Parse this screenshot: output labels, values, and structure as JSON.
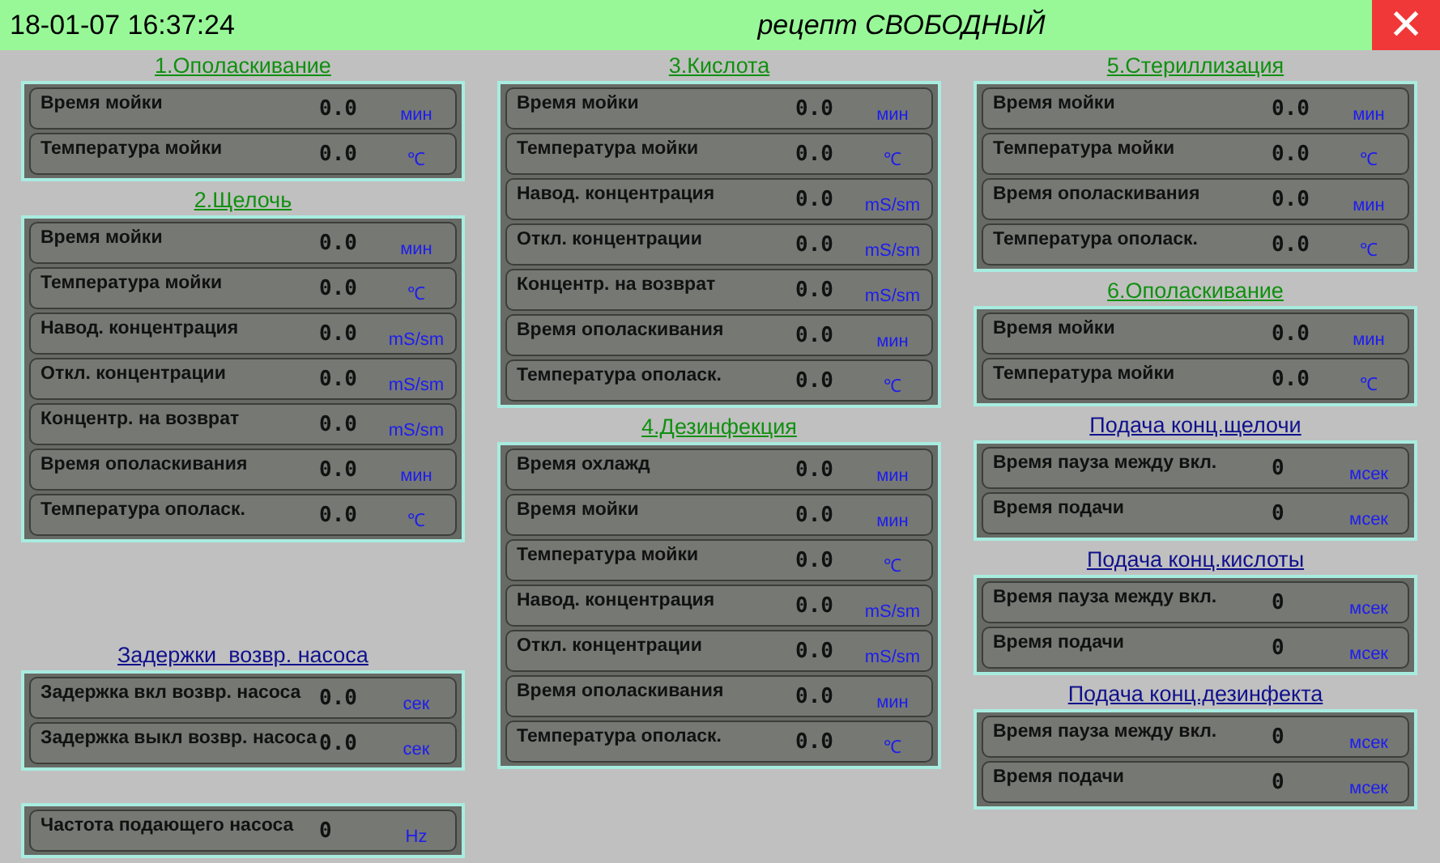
{
  "header": {
    "datetime": "18-01-07 16:37:24",
    "title": "рецепт СВОБОДНЫЙ",
    "close": "✕"
  },
  "columns": [
    {
      "groups": [
        {
          "title": "1.Ополаскивание",
          "kind": "section",
          "rows": [
            {
              "label": "Время мойки",
              "value": "0.0",
              "unit": "мин"
            },
            {
              "label": "Температура мойки",
              "value": "0.0",
              "unit": "℃"
            }
          ]
        },
        {
          "title": "2.Щелочь",
          "kind": "section",
          "rows": [
            {
              "label": "Время мойки",
              "value": "0.0",
              "unit": "мин"
            },
            {
              "label": "Температура мойки",
              "value": "0.0",
              "unit": "℃"
            },
            {
              "label": "Навод. концентрация",
              "value": "0.0",
              "unit": "mS/sm"
            },
            {
              "label": "Откл. концентрации",
              "value": "0.0",
              "unit": "mS/sm"
            },
            {
              "label": "Концентр. на возврат",
              "value": "0.0",
              "unit": "mS/sm"
            },
            {
              "label": "Время ополаскивания",
              "value": "0.0",
              "unit": "мин"
            },
            {
              "label": "Температура ополаск.",
              "value": "0.0",
              "unit": "℃"
            }
          ]
        },
        {
          "title": "Задержки  возвр. насоса",
          "kind": "link",
          "rows": [
            {
              "label": "Задержка вкл возвр. насоса",
              "value": "0.0",
              "unit": "сек"
            },
            {
              "label": "Задержка выкл возвр. насоса",
              "value": "0.0",
              "unit": "сек"
            }
          ]
        },
        {
          "kind": "plain",
          "rows": [
            {
              "label": "Частота подающего насоса",
              "value": "0",
              "unit": "Hz"
            }
          ]
        }
      ]
    },
    {
      "groups": [
        {
          "title": "3.Кислота",
          "kind": "section",
          "rows": [
            {
              "label": "Время мойки",
              "value": "0.0",
              "unit": "мин"
            },
            {
              "label": "Температура мойки",
              "value": "0.0",
              "unit": "℃"
            },
            {
              "label": "Навод. концентрация",
              "value": "0.0",
              "unit": "mS/sm"
            },
            {
              "label": "Откл. концентрации",
              "value": "0.0",
              "unit": "mS/sm"
            },
            {
              "label": "Концентр. на возврат",
              "value": "0.0",
              "unit": "mS/sm"
            },
            {
              "label": "Время ополаскивания",
              "value": "0.0",
              "unit": "мин"
            },
            {
              "label": "Температура ополаск.",
              "value": "0.0",
              "unit": "℃"
            }
          ]
        },
        {
          "title": "4.Дезинфекция",
          "kind": "section",
          "rows": [
            {
              "label": "Время охлажд",
              "value": "0.0",
              "unit": "мин"
            },
            {
              "label": "Время мойки",
              "value": "0.0",
              "unit": "мин"
            },
            {
              "label": "Температура мойки",
              "value": "0.0",
              "unit": "℃"
            },
            {
              "label": "Навод. концентрация",
              "value": "0.0",
              "unit": "mS/sm"
            },
            {
              "label": "Откл. концентрации",
              "value": "0.0",
              "unit": "mS/sm"
            },
            {
              "label": "Время ополаскивания",
              "value": "0.0",
              "unit": "мин"
            },
            {
              "label": "Температура ополаск.",
              "value": "0.0",
              "unit": "℃"
            }
          ]
        }
      ]
    },
    {
      "groups": [
        {
          "title": "5.Стериллизация",
          "kind": "section",
          "rows": [
            {
              "label": "Время мойки",
              "value": "0.0",
              "unit": "мин"
            },
            {
              "label": "Температура мойки",
              "value": "0.0",
              "unit": "℃"
            },
            {
              "label": "Время ополаскивания",
              "value": "0.0",
              "unit": "мин"
            },
            {
              "label": "Температура ополаск.",
              "value": "0.0",
              "unit": "℃"
            }
          ]
        },
        {
          "title": "6.Ополаскивание",
          "kind": "section",
          "rows": [
            {
              "label": "Время мойки",
              "value": "0.0",
              "unit": "мин"
            },
            {
              "label": "Температура мойки",
              "value": "0.0",
              "unit": "℃"
            }
          ]
        },
        {
          "title": "Подача конц.щелочи",
          "kind": "link",
          "rows": [
            {
              "label": "Время пауза между вкл.",
              "value": "0",
              "unit": "мсек"
            },
            {
              "label": "Время подачи",
              "value": "0",
              "unit": "мсек"
            }
          ]
        },
        {
          "title": "Подача конц.кислоты",
          "kind": "link",
          "rows": [
            {
              "label": "Время пауза между вкл.",
              "value": "0",
              "unit": "мсек"
            },
            {
              "label": "Время подачи",
              "value": "0",
              "unit": "мсек"
            }
          ]
        },
        {
          "title": "Подача конц.дезинфекта",
          "kind": "link",
          "rows": [
            {
              "label": "Время пауза между вкл.",
              "value": "0",
              "unit": "мсек"
            },
            {
              "label": "Время подачи",
              "value": "0",
              "unit": "мсек"
            }
          ]
        }
      ]
    }
  ]
}
